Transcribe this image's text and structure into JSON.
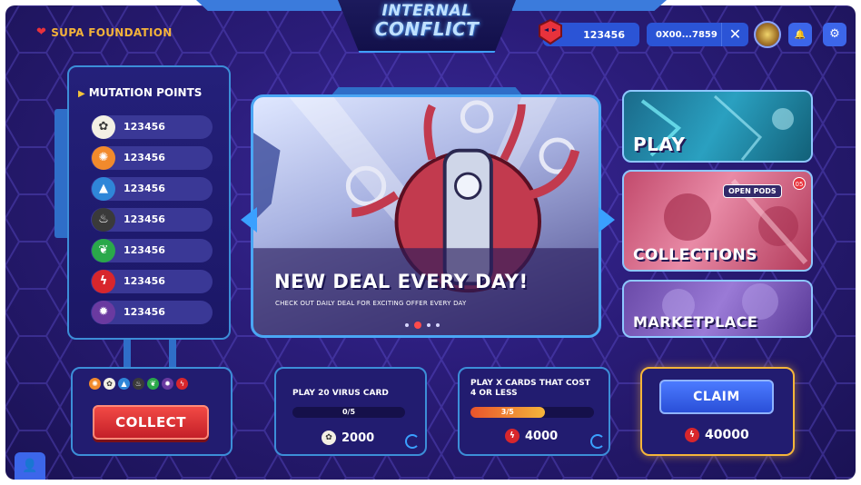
{
  "brand": {
    "name": "SUPA FOUNDATION"
  },
  "game": {
    "title_line1": "INTERNAL",
    "title_line2": "CONFLICT"
  },
  "header": {
    "gem_balance": "123456",
    "wallet_address": "0X00...7859",
    "close_symbol": "✕",
    "bell_symbol": "🔔",
    "settings_symbol": "⚙"
  },
  "mutation": {
    "title": "MUTATION POINTS",
    "items": [
      {
        "value": "123456",
        "icon": "lotus-icon",
        "color": "#f3f0e4"
      },
      {
        "value": "123456",
        "icon": "sun-virus-icon",
        "color": "#f28a2c"
      },
      {
        "value": "123456",
        "icon": "triangle-virus-icon",
        "color": "#2f86d8"
      },
      {
        "value": "123456",
        "icon": "flame-virus-icon",
        "color": "#3a3a3a"
      },
      {
        "value": "123456",
        "icon": "leaf-virus-icon",
        "color": "#2aa84a"
      },
      {
        "value": "123456",
        "icon": "bolt-virus-icon",
        "color": "#d8262c"
      },
      {
        "value": "123456",
        "icon": "spider-virus-icon",
        "color": "#6a3aa0"
      }
    ]
  },
  "collect": {
    "label": "COLLECT"
  },
  "banner": {
    "headline": "NEW DEAL EVERY DAY!",
    "subtext": "CHECK OUT DAILY DEAL FOR EXCITING OFFER EVERY DAY",
    "slides": 4,
    "active_slide": 2
  },
  "menu": {
    "play": "PLAY",
    "collections": "COLLECTIONS",
    "open_pods": "OPEN PODS",
    "open_pods_count": "05",
    "marketplace": "MARKETPLACE"
  },
  "quests": [
    {
      "title": "PLAY 20 VIRUS CARD",
      "progress_text": "0/5",
      "progress": 0,
      "reward": "2000",
      "reward_icon": "lotus-icon"
    },
    {
      "title": "PLAY X CARDS THAT COST 4 OR LESS",
      "progress_text": "3/5",
      "progress": 0.6,
      "reward": "4000",
      "reward_icon": "bolt-virus-icon"
    }
  ],
  "claim": {
    "label": "CLAIM",
    "reward": "40000",
    "reward_icon": "bolt-virus-icon"
  },
  "colors": {
    "accent": "#3c8ed8",
    "gold": "#f5b53a",
    "red": "#e8323c",
    "bg": "#2a1c78"
  }
}
